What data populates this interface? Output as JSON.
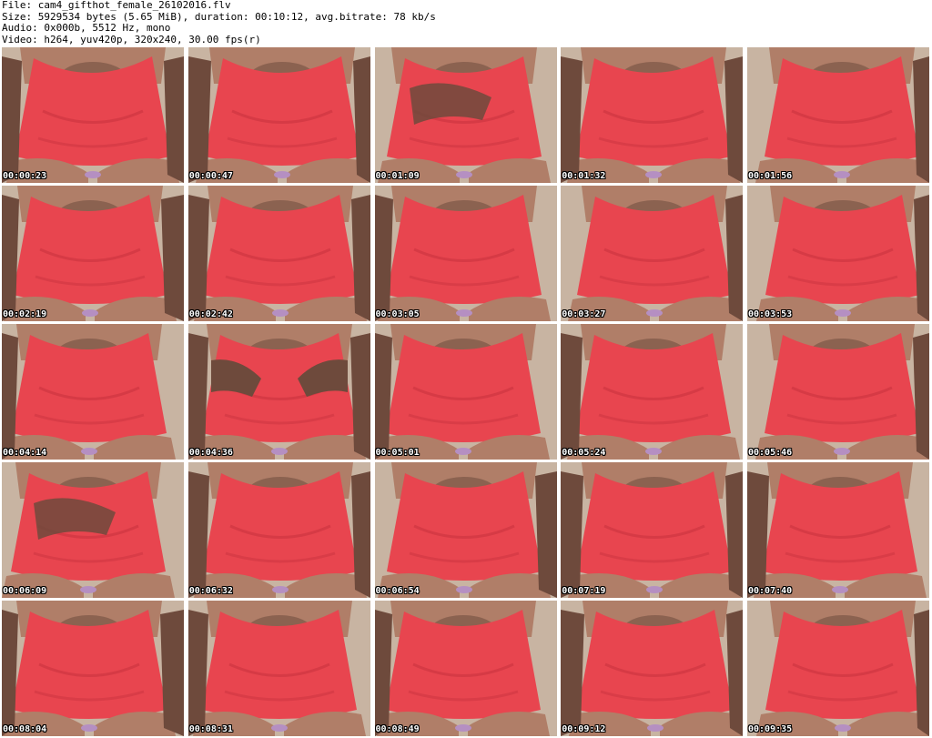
{
  "header": {
    "file": "File: cam4_gifthot_female_26102016.flv",
    "size": "Size: 5929534 bytes (5.65 MiB), duration: 00:10:12, avg.bitrate: 78 kb/s",
    "audio": "Audio: 0x000b, 5512 Hz, mono",
    "video": "Video: h264, yuv420p, 320x240, 30.00 fps(r)"
  },
  "thumbnails": [
    {
      "time": "00:00:23"
    },
    {
      "time": "00:00:47"
    },
    {
      "time": "00:01:09"
    },
    {
      "time": "00:01:32"
    },
    {
      "time": "00:01:56"
    },
    {
      "time": "00:02:19"
    },
    {
      "time": "00:02:42"
    },
    {
      "time": "00:03:05"
    },
    {
      "time": "00:03:27"
    },
    {
      "time": "00:03:53"
    },
    {
      "time": "00:04:14"
    },
    {
      "time": "00:04:36"
    },
    {
      "time": "00:05:01"
    },
    {
      "time": "00:05:24"
    },
    {
      "time": "00:05:46"
    },
    {
      "time": "00:06:09"
    },
    {
      "time": "00:06:32"
    },
    {
      "time": "00:06:54"
    },
    {
      "time": "00:07:19"
    },
    {
      "time": "00:07:40"
    },
    {
      "time": "00:08:04"
    },
    {
      "time": "00:08:31"
    },
    {
      "time": "00:08:49"
    },
    {
      "time": "00:09:12"
    },
    {
      "time": "00:09:35"
    }
  ],
  "colors": {
    "garment": "#e8454f",
    "garment_shade": "#c9343f",
    "skin": "#6e4a3c",
    "skin_light": "#b07e68",
    "background_wall": "#d9cdbd"
  }
}
